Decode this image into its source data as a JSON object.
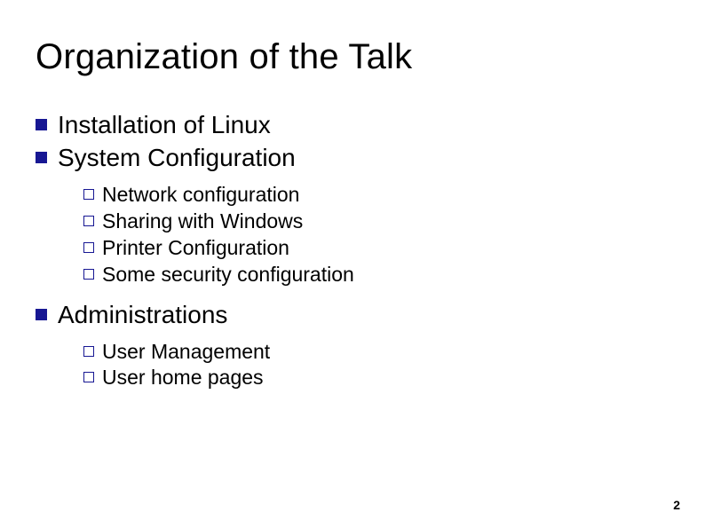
{
  "title": "Organization of the Talk",
  "items": [
    {
      "label": "Installation of Linux"
    },
    {
      "label": "System Configuration",
      "sub": [
        {
          "label": "Network configuration"
        },
        {
          "label": "Sharing with Windows"
        },
        {
          "label": "Printer Configuration"
        },
        {
          "label": "Some security configuration"
        }
      ]
    },
    {
      "label": "Administrations",
      "sub": [
        {
          "label": "User Management"
        },
        {
          "label": "User home pages"
        }
      ]
    }
  ],
  "page_number": "2"
}
